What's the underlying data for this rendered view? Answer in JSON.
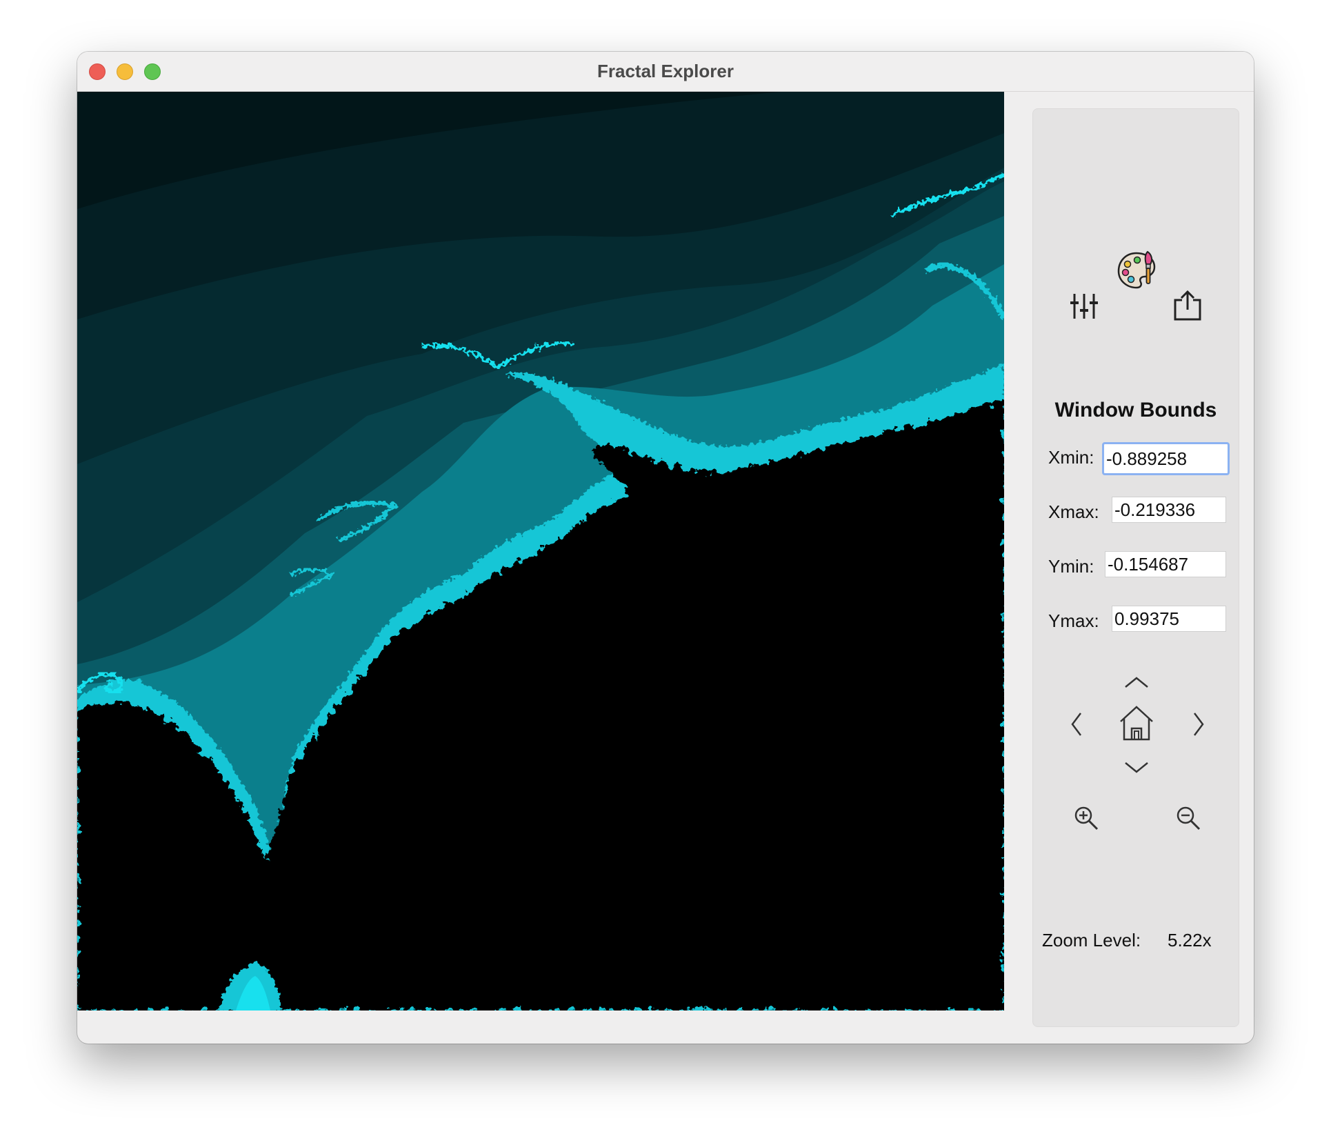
{
  "window": {
    "title": "Fractal Explorer"
  },
  "fractal": {
    "palette": [
      "#000000",
      "#021619",
      "#04262b",
      "#063a41",
      "#085a63",
      "#0a8793",
      "#12c6d6",
      "#18e0ee"
    ]
  },
  "panel": {
    "section_title": "Window Bounds",
    "fields": [
      {
        "label": "Xmin:",
        "value": "-0.889258"
      },
      {
        "label": "Xmax:",
        "value": "-0.219336"
      },
      {
        "label": "Ymin:",
        "value": "-0.154687"
      },
      {
        "label": "Ymax:",
        "value": "0.99375"
      }
    ],
    "zoom_label": "Zoom Level:",
    "zoom_value": "5.22x"
  },
  "icons": {
    "palette": "palette-icon",
    "sliders": "sliders-icon",
    "share": "share-icon",
    "up": "chevron-up-icon",
    "down": "chevron-down-icon",
    "left": "chevron-left-icon",
    "right": "chevron-right-icon",
    "home": "home-icon",
    "zoom_in": "zoom-in-icon",
    "zoom_out": "zoom-out-icon"
  }
}
